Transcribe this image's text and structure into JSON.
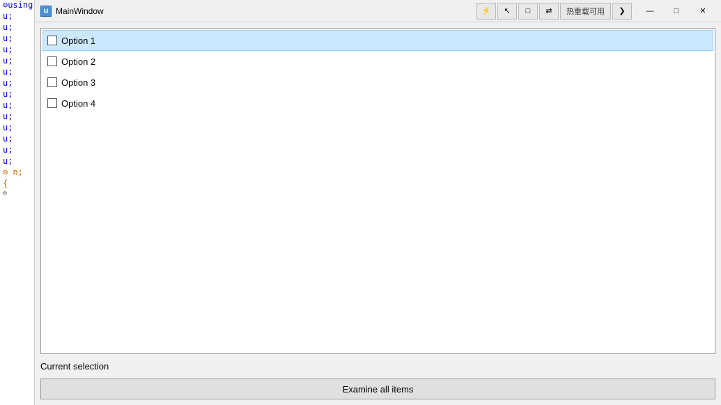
{
  "editor": {
    "lines": [
      {
        "text": "using System;",
        "type": "blue",
        "prefix": "⊖"
      },
      {
        "text": "u;",
        "type": "blue"
      },
      {
        "text": "u;",
        "type": "blue"
      },
      {
        "text": "u;",
        "type": "blue"
      },
      {
        "text": "u;",
        "type": "blue"
      },
      {
        "text": "u;",
        "type": "blue"
      },
      {
        "text": "u;",
        "type": "blue"
      },
      {
        "text": "u;",
        "type": "blue"
      },
      {
        "text": "u;",
        "type": "blue"
      },
      {
        "text": "u;",
        "type": "blue"
      },
      {
        "text": "u;",
        "type": "blue"
      },
      {
        "text": "u;",
        "type": "blue"
      },
      {
        "text": "u;",
        "type": "blue"
      },
      {
        "text": "u;",
        "type": "blue"
      },
      {
        "text": "u;",
        "type": "blue"
      },
      {
        "text": "⊖ n;",
        "type": "orange"
      },
      {
        "text": "{",
        "type": "orange"
      },
      {
        "text": "⊖",
        "type": "collapse"
      },
      {
        "text": "",
        "type": "blue"
      },
      {
        "text": "",
        "type": "blue"
      },
      {
        "text": "",
        "type": "blue"
      }
    ]
  },
  "titleBar": {
    "icon": "M",
    "title": "MainWindow",
    "tools": [
      {
        "label": "⚡",
        "name": "run-tool"
      },
      {
        "label": "↖",
        "name": "select-tool"
      },
      {
        "label": "□",
        "name": "window-tool"
      },
      {
        "label": "⇄",
        "name": "swap-tool"
      }
    ],
    "hotReload": "热重载可用",
    "chevron": "❯",
    "minimize": "—",
    "maximize": "□",
    "close": "✕"
  },
  "listbox": {
    "items": [
      {
        "label": "Option 1",
        "checked": false,
        "selected": true
      },
      {
        "label": "Option 2",
        "checked": false,
        "selected": false
      },
      {
        "label": "Option 3",
        "checked": false,
        "selected": false
      },
      {
        "label": "Option 4",
        "checked": false,
        "selected": false
      }
    ]
  },
  "status": {
    "label": "Current selection"
  },
  "button": {
    "label": "Examine all items"
  }
}
